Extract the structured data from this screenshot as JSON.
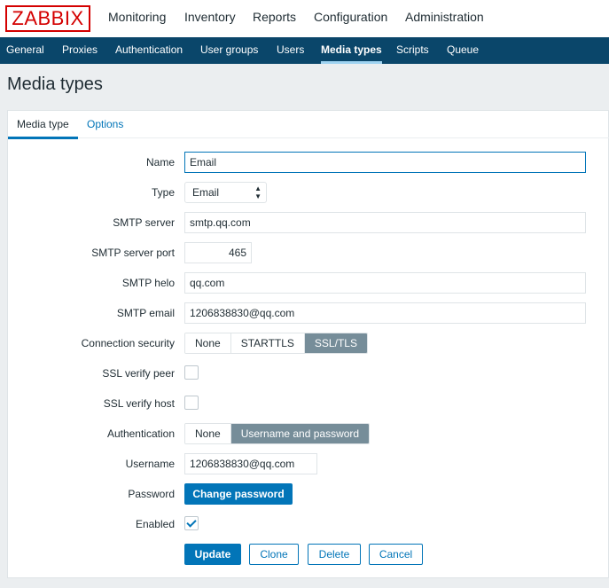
{
  "logo": "ZABBIX",
  "top_nav": [
    "Monitoring",
    "Inventory",
    "Reports",
    "Configuration",
    "Administration"
  ],
  "sub_nav": [
    "General",
    "Proxies",
    "Authentication",
    "User groups",
    "Users",
    "Media types",
    "Scripts",
    "Queue"
  ],
  "page_title": "Media types",
  "tabs": [
    "Media type",
    "Options"
  ],
  "form": {
    "name_label": "Name",
    "name_value": "Email",
    "type_label": "Type",
    "type_value": "Email",
    "smtp_server_label": "SMTP server",
    "smtp_server_value": "smtp.qq.com",
    "smtp_port_label": "SMTP server port",
    "smtp_port_value": "465",
    "smtp_helo_label": "SMTP helo",
    "smtp_helo_value": "qq.com",
    "smtp_email_label": "SMTP email",
    "smtp_email_value": "1206838830@qq.com",
    "conn_security_label": "Connection security",
    "conn_security_options": [
      "None",
      "STARTTLS",
      "SSL/TLS"
    ],
    "conn_security_selected": "SSL/TLS",
    "ssl_verify_peer_label": "SSL verify peer",
    "ssl_verify_peer_checked": false,
    "ssl_verify_host_label": "SSL verify host",
    "ssl_verify_host_checked": false,
    "auth_label": "Authentication",
    "auth_options": [
      "None",
      "Username and password"
    ],
    "auth_selected": "Username and password",
    "username_label": "Username",
    "username_value": "1206838830@qq.com",
    "password_label": "Password",
    "change_password_button": "Change password",
    "enabled_label": "Enabled",
    "enabled_checked": true
  },
  "buttons": {
    "update": "Update",
    "clone": "Clone",
    "delete": "Delete",
    "cancel": "Cancel"
  },
  "colors": {
    "header_bg": "#0a466a",
    "accent": "#0275b8",
    "logo_red": "#d40000",
    "segment_selected": "#768d99"
  }
}
